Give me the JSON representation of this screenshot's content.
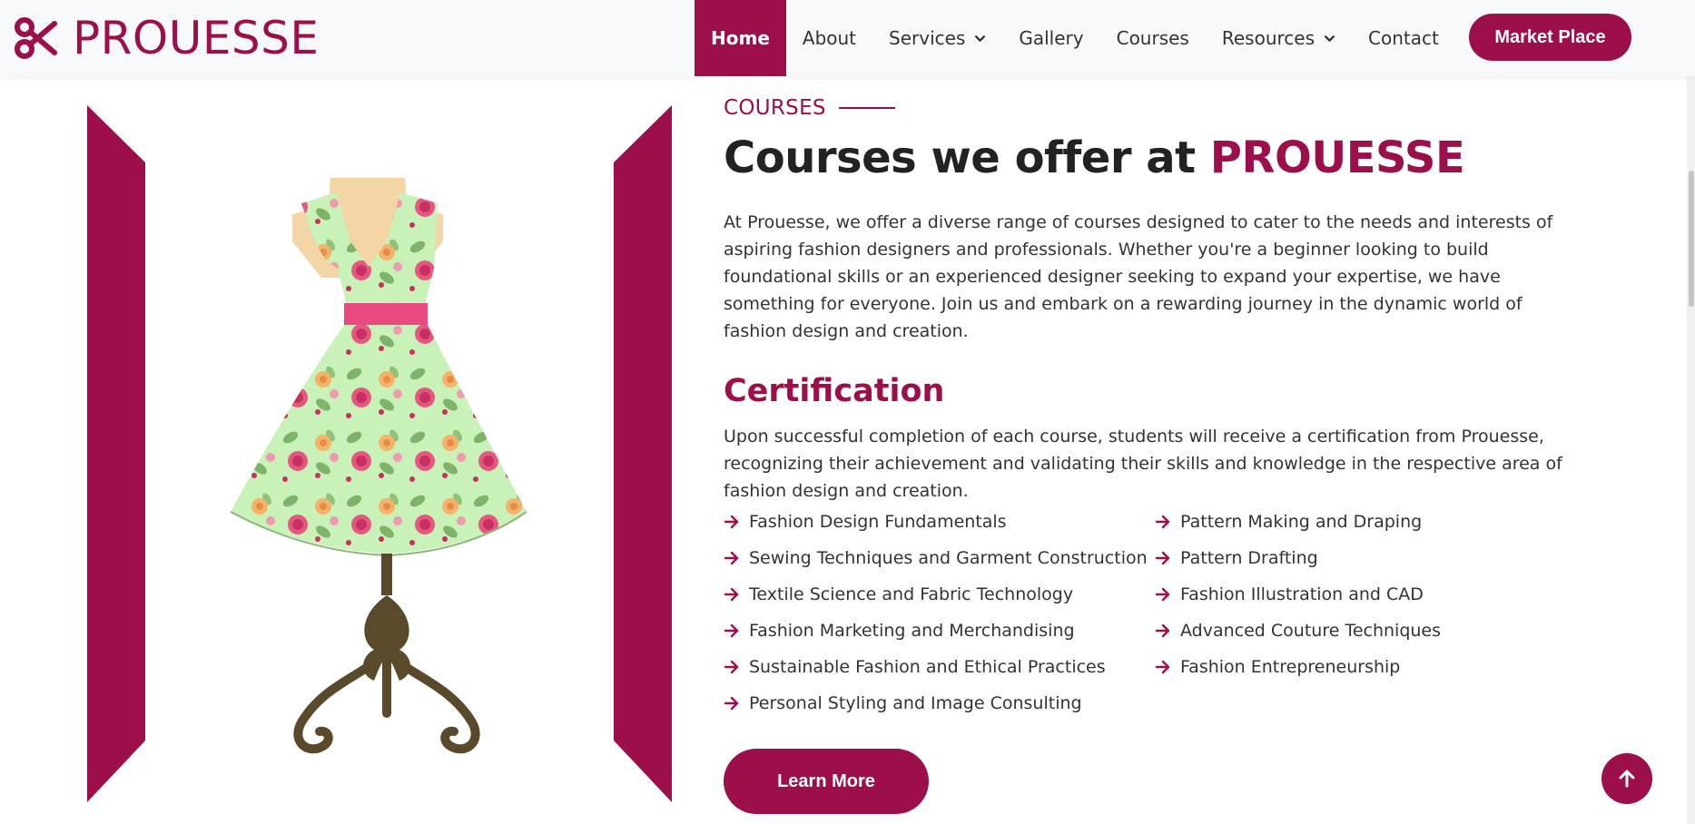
{
  "brand": {
    "name": "PROUESSE",
    "accent_color": "#9c0f4b",
    "logo_icon": "scissors-icon"
  },
  "nav": {
    "items": [
      {
        "label": "Home",
        "active": true,
        "dropdown": false
      },
      {
        "label": "About",
        "active": false,
        "dropdown": false
      },
      {
        "label": "Services",
        "active": false,
        "dropdown": true
      },
      {
        "label": "Gallery",
        "active": false,
        "dropdown": false
      },
      {
        "label": "Courses",
        "active": false,
        "dropdown": false
      },
      {
        "label": "Resources",
        "active": false,
        "dropdown": true
      },
      {
        "label": "Contact",
        "active": false,
        "dropdown": false
      }
    ],
    "market_button": "Market Place"
  },
  "section": {
    "eyebrow": "COURSES",
    "heading_prefix": "Courses we offer at ",
    "heading_accent": "PROUESSE",
    "intro": "At Prouesse, we offer a diverse range of courses designed to cater to the needs and interests of aspiring fashion designers and professionals. Whether you're a beginner looking to build foundational skills or an experienced designer seeking to expand your expertise, we have something for everyone. Join us and embark on a rewarding journey in the dynamic world of fashion design and creation.",
    "cert_title": "Certification",
    "cert_text": "Upon successful completion of each course, students will receive a certification from Prouesse, recognizing their achievement and validating their skills and knowledge in the respective area of fashion design and creation.",
    "courses_left": [
      "Fashion Design Fundamentals",
      "Sewing Techniques and Garment Construction",
      "Textile Science and Fabric Technology",
      "Fashion Marketing and Merchandising",
      "Sustainable Fashion and Ethical Practices",
      "Personal Styling and Image Consulting"
    ],
    "courses_right": [
      "Pattern Making and Draping",
      "Pattern Drafting",
      "Fashion Illustration and CAD",
      "Advanced Couture Techniques",
      "Fashion Entrepreneurship"
    ],
    "learn_more": "Learn More"
  },
  "icons": {
    "list_bullet": "arrow-right-icon",
    "back_to_top": "arrow-up-icon",
    "dropdown": "chevron-down-icon"
  }
}
